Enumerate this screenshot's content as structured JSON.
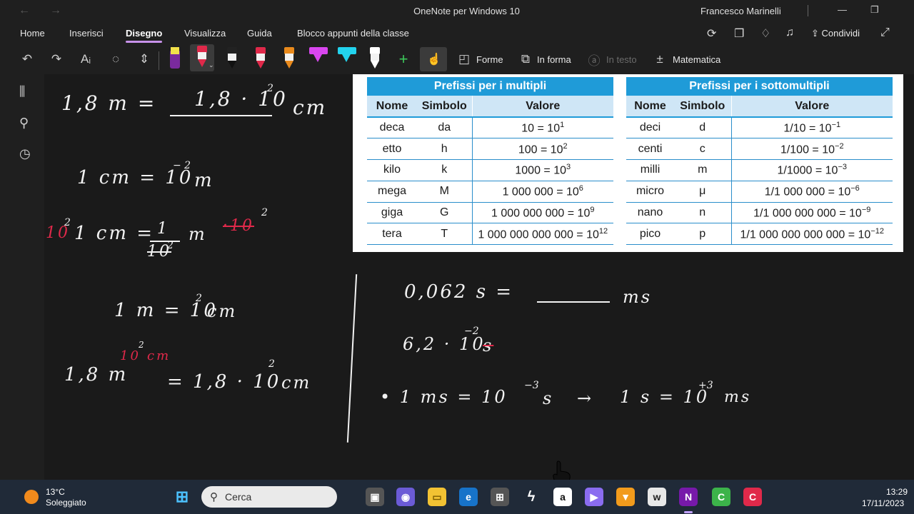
{
  "window": {
    "title": "OneNote per Windows 10",
    "user": "Francesco Marinelli",
    "back_icon": "back-arrow-icon",
    "forward_icon": "forward-arrow-icon",
    "minimize_icon": "minimize-icon",
    "restore_icon": "restore-icon"
  },
  "menu": {
    "items": [
      "Home",
      "Inserisci",
      "Disegno",
      "Visualizza",
      "Guida",
      "Blocco appunti della classe"
    ],
    "active": "Disegno",
    "share_label": "Condividi",
    "accent": "#c792ea"
  },
  "toolbar": {
    "shapes_label": "Forme",
    "inform_label": "In forma",
    "intesto_label": "In testo",
    "math_label": "Matematica",
    "pen_colors": [
      "#7a2a9e",
      "#e0294a",
      "#222222",
      "#e0294a",
      "#e98a1c",
      "#d946ef",
      "#22d3ee",
      "#ffffff"
    ]
  },
  "sidebar": {
    "icons": [
      "notebooks-icon",
      "search-icon",
      "recent-icon"
    ]
  },
  "table_multipli": {
    "title": "Prefissi per i multipli",
    "headers": [
      "Nome",
      "Simbolo",
      "Valore"
    ],
    "rows": [
      {
        "nome": "deca",
        "simbolo": "da",
        "base": "10 = 10",
        "exp": "1"
      },
      {
        "nome": "etto",
        "simbolo": "h",
        "base": "100 = 10",
        "exp": "2"
      },
      {
        "nome": "kilo",
        "simbolo": "k",
        "base": "1000 = 10",
        "exp": "3"
      },
      {
        "nome": "mega",
        "simbolo": "M",
        "base": "1 000 000 = 10",
        "exp": "6"
      },
      {
        "nome": "giga",
        "simbolo": "G",
        "base": "1 000 000 000 = 10",
        "exp": "9"
      },
      {
        "nome": "tera",
        "simbolo": "T",
        "base": "1 000 000 000 000 = 10",
        "exp": "12"
      }
    ]
  },
  "table_sottomultipli": {
    "title": "Prefissi per i sottomultipli",
    "headers": [
      "Nome",
      "Simbolo",
      "Valore"
    ],
    "rows": [
      {
        "nome": "deci",
        "simbolo": "d",
        "base": "1/10 = 10",
        "exp": "−1"
      },
      {
        "nome": "centi",
        "simbolo": "c",
        "base": "1/100 = 10",
        "exp": "−2"
      },
      {
        "nome": "milli",
        "simbolo": "m",
        "base": "1/1000 = 10",
        "exp": "−3"
      },
      {
        "nome": "micro",
        "simbolo": "μ",
        "base": "1/1 000 000 = 10",
        "exp": "−6"
      },
      {
        "nome": "nano",
        "simbolo": "n",
        "base": "1/1 000 000 000 = 10",
        "exp": "−9"
      },
      {
        "nome": "pico",
        "simbolo": "p",
        "base": "1/1 000 000 000 000 = 10",
        "exp": "−12"
      }
    ]
  },
  "notes": {
    "l1_left": "1,8 m =",
    "l1_blank": "1,8 · 10",
    "l1_exp": "2",
    "l1_unit": "cm",
    "l2": "1 cm = 10",
    "l2_exp": "− 2",
    "l2_unit": "m",
    "l3_red": "10",
    "l3_red_exp": "2",
    "l3": "1 cm =",
    "l3_num": "1",
    "l3_m": "m",
    "l3_cross": "·10",
    "l3_cross_exp": "2",
    "l3_den": "10",
    "l3_den_exp": "2",
    "l4": "1 m = 10",
    "l4_exp": "2",
    "l4_unit": "cm",
    "l5_red": "10",
    "l5_red_exp": "2",
    "l5_red_unit": "cm",
    "l5_left": "1,8 m",
    "l5_right": "= 1,8 · 10",
    "l5_exp": "2",
    "l5_unit": "cm",
    "r1": "0,062 s =",
    "r1_unit": "ms",
    "r2": "6,2 · 10",
    "r2_exp": "−2",
    "r2_s": "s",
    "r3": "• 1 ms = 10",
    "r3_exp": "−3",
    "r3_s": "s",
    "r3_arrow": "→",
    "r3_right": "1 s = 10",
    "r3_right_exp": "+3",
    "r3_right_unit": "ms"
  },
  "taskbar": {
    "temperature": "13°C",
    "weather": "Soleggiato",
    "search_placeholder": "Cerca",
    "time": "13:29",
    "date": "17/11/2023"
  }
}
